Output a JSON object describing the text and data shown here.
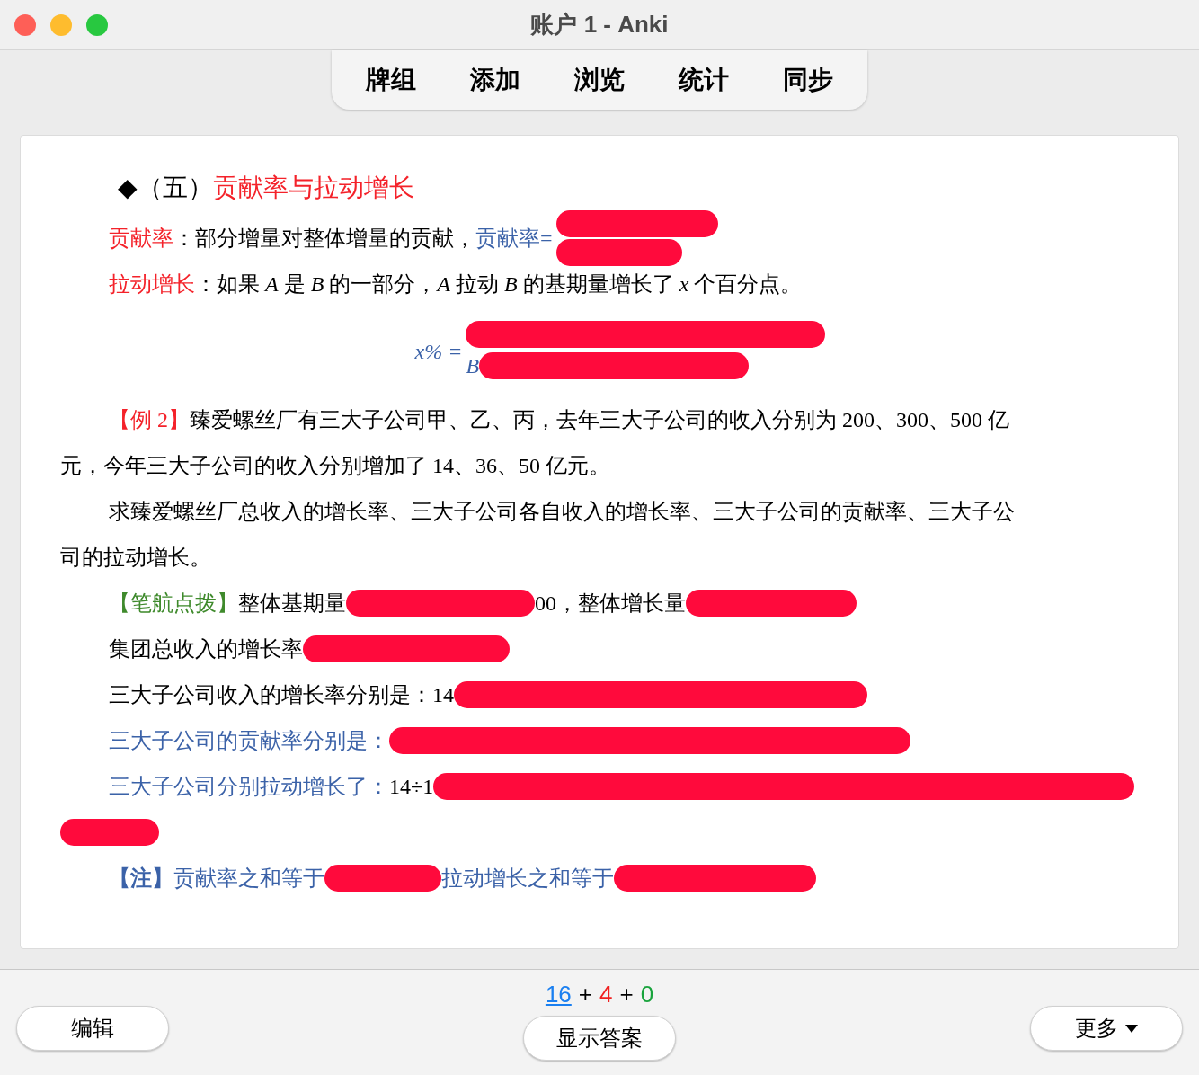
{
  "window": {
    "title": "账户 1 - Anki"
  },
  "toolbar": {
    "links": [
      "牌组",
      "添加",
      "浏览",
      "统计",
      "同步"
    ]
  },
  "card": {
    "lines": [
      {
        "kind": "heading",
        "indent": true,
        "segments": [
          {
            "kind": "text",
            "text": "◆",
            "color": "#000000"
          },
          {
            "kind": "text",
            "text": "（五）",
            "color": "#000000"
          },
          {
            "kind": "text",
            "text": "贡献率与拉动增长",
            "color": "#f4222a"
          }
        ]
      },
      {
        "kind": "text",
        "indent": true,
        "segments": [
          {
            "kind": "text",
            "text": "贡献率",
            "color": "#f4222a"
          },
          {
            "kind": "text",
            "text": "：部分增量对整体增量的贡献，",
            "color": "#000000"
          },
          {
            "kind": "text",
            "text": "贡献率=",
            "color": "#3b62a8"
          },
          {
            "kind": "fraction",
            "numerator": [
              {
                "kind": "redaction"
              }
            ],
            "denominator": [
              {
                "kind": "redaction"
              }
            ]
          }
        ]
      },
      {
        "kind": "text",
        "indent": true,
        "segments": [
          {
            "kind": "text",
            "text": "拉动增长",
            "color": "#f4222a"
          },
          {
            "kind": "text",
            "text": "：如果 ",
            "color": "#000000"
          },
          {
            "kind": "math",
            "text": "A",
            "color": "#000000"
          },
          {
            "kind": "text",
            "text": " 是 ",
            "color": "#000000"
          },
          {
            "kind": "math",
            "text": "B",
            "color": "#000000"
          },
          {
            "kind": "text",
            "text": " 的一部分，",
            "color": "#000000"
          },
          {
            "kind": "math",
            "text": "A",
            "color": "#000000"
          },
          {
            "kind": "text",
            "text": " 拉动 ",
            "color": "#000000"
          },
          {
            "kind": "math",
            "text": "B",
            "color": "#000000"
          },
          {
            "kind": "text",
            "text": " 的基期量增长了 ",
            "color": "#000000"
          },
          {
            "kind": "math",
            "text": "x",
            "color": "#000000"
          },
          {
            "kind": "text",
            "text": " 个百分点。",
            "color": "#000000"
          }
        ]
      },
      {
        "kind": "formula",
        "indent": false,
        "segments": [
          {
            "kind": "math",
            "text": "x% =",
            "color": "#3b62a8"
          },
          {
            "kind": "fraction",
            "numerator": [
              {
                "kind": "redaction"
              }
            ],
            "denominator": [
              {
                "kind": "math",
                "text": "B",
                "color": "#3b62a8"
              },
              {
                "kind": "redaction"
              }
            ]
          }
        ]
      },
      {
        "kind": "text",
        "indent": true,
        "segments": [
          {
            "kind": "text",
            "text": "【例 2】",
            "color": "#f4222a"
          },
          {
            "kind": "text",
            "text": "臻爱螺丝厂有三大子公司甲、乙、丙，去年三大子公司的收入分别为 200、300、500 亿",
            "color": "#000000"
          }
        ]
      },
      {
        "kind": "text",
        "indent": false,
        "segments": [
          {
            "kind": "text",
            "text": "元，今年三大子公司的收入分别增加了 14、36、50 亿元。",
            "color": "#000000"
          }
        ]
      },
      {
        "kind": "text",
        "indent": true,
        "segments": [
          {
            "kind": "text",
            "text": "求臻爱螺丝厂总收入的增长率、三大子公司各自收入的增长率、三大子公司的贡献率、三大子公",
            "color": "#000000"
          }
        ]
      },
      {
        "kind": "text",
        "indent": false,
        "segments": [
          {
            "kind": "text",
            "text": "司的拉动增长。",
            "color": "#000000"
          }
        ]
      },
      {
        "kind": "text",
        "indent": true,
        "segments": [
          {
            "kind": "text",
            "text": "【笔航点拨】",
            "color": "#3f8a2c"
          },
          {
            "kind": "text",
            "text": "整体基期量",
            "color": "#000000"
          },
          {
            "kind": "redaction"
          },
          {
            "kind": "text",
            "text": "00，整体增长量",
            "color": "#000000"
          },
          {
            "kind": "redaction"
          }
        ]
      },
      {
        "kind": "text",
        "indent": true,
        "segments": [
          {
            "kind": "text",
            "text": "集团总收入的增长率",
            "color": "#000000"
          },
          {
            "kind": "redaction"
          }
        ]
      },
      {
        "kind": "text",
        "indent": true,
        "segments": [
          {
            "kind": "text",
            "text": "三大子公司收入的增长率分别是：14",
            "color": "#000000"
          },
          {
            "kind": "redaction"
          }
        ]
      },
      {
        "kind": "text",
        "indent": true,
        "segments": [
          {
            "kind": "text",
            "text": "三大子公司的贡献率分别是：",
            "color": "#3b62a8"
          },
          {
            "kind": "redaction"
          }
        ]
      },
      {
        "kind": "text",
        "indent": true,
        "segments": [
          {
            "kind": "text",
            "text": "三大子公司分别拉动增长了：",
            "color": "#3b62a8"
          },
          {
            "kind": "text",
            "text": "14÷1",
            "color": "#000000"
          },
          {
            "kind": "redaction"
          }
        ]
      },
      {
        "kind": "text",
        "indent": false,
        "segments": [
          {
            "kind": "redaction"
          }
        ]
      },
      {
        "kind": "text",
        "indent": true,
        "segments": [
          {
            "kind": "text",
            "text": "【注】",
            "color": "#3b62a8",
            "bold": true
          },
          {
            "kind": "text",
            "text": "贡献率之和等于",
            "color": "#3b62a8"
          },
          {
            "kind": "redaction"
          },
          {
            "kind": "text",
            "text": "拉动增长之和等于",
            "color": "#3b62a8"
          },
          {
            "kind": "redaction"
          }
        ]
      }
    ]
  },
  "counts": [
    {
      "value": "16",
      "color": "#1a7ff0",
      "underlined": true
    },
    {
      "prefix": "+",
      "value": "4",
      "color": "#f02020"
    },
    {
      "prefix": "+",
      "value": "0",
      "color": "#18a33c"
    }
  ],
  "buttons": {
    "edit": "编辑",
    "answer": "显示答案",
    "more": "更多"
  }
}
